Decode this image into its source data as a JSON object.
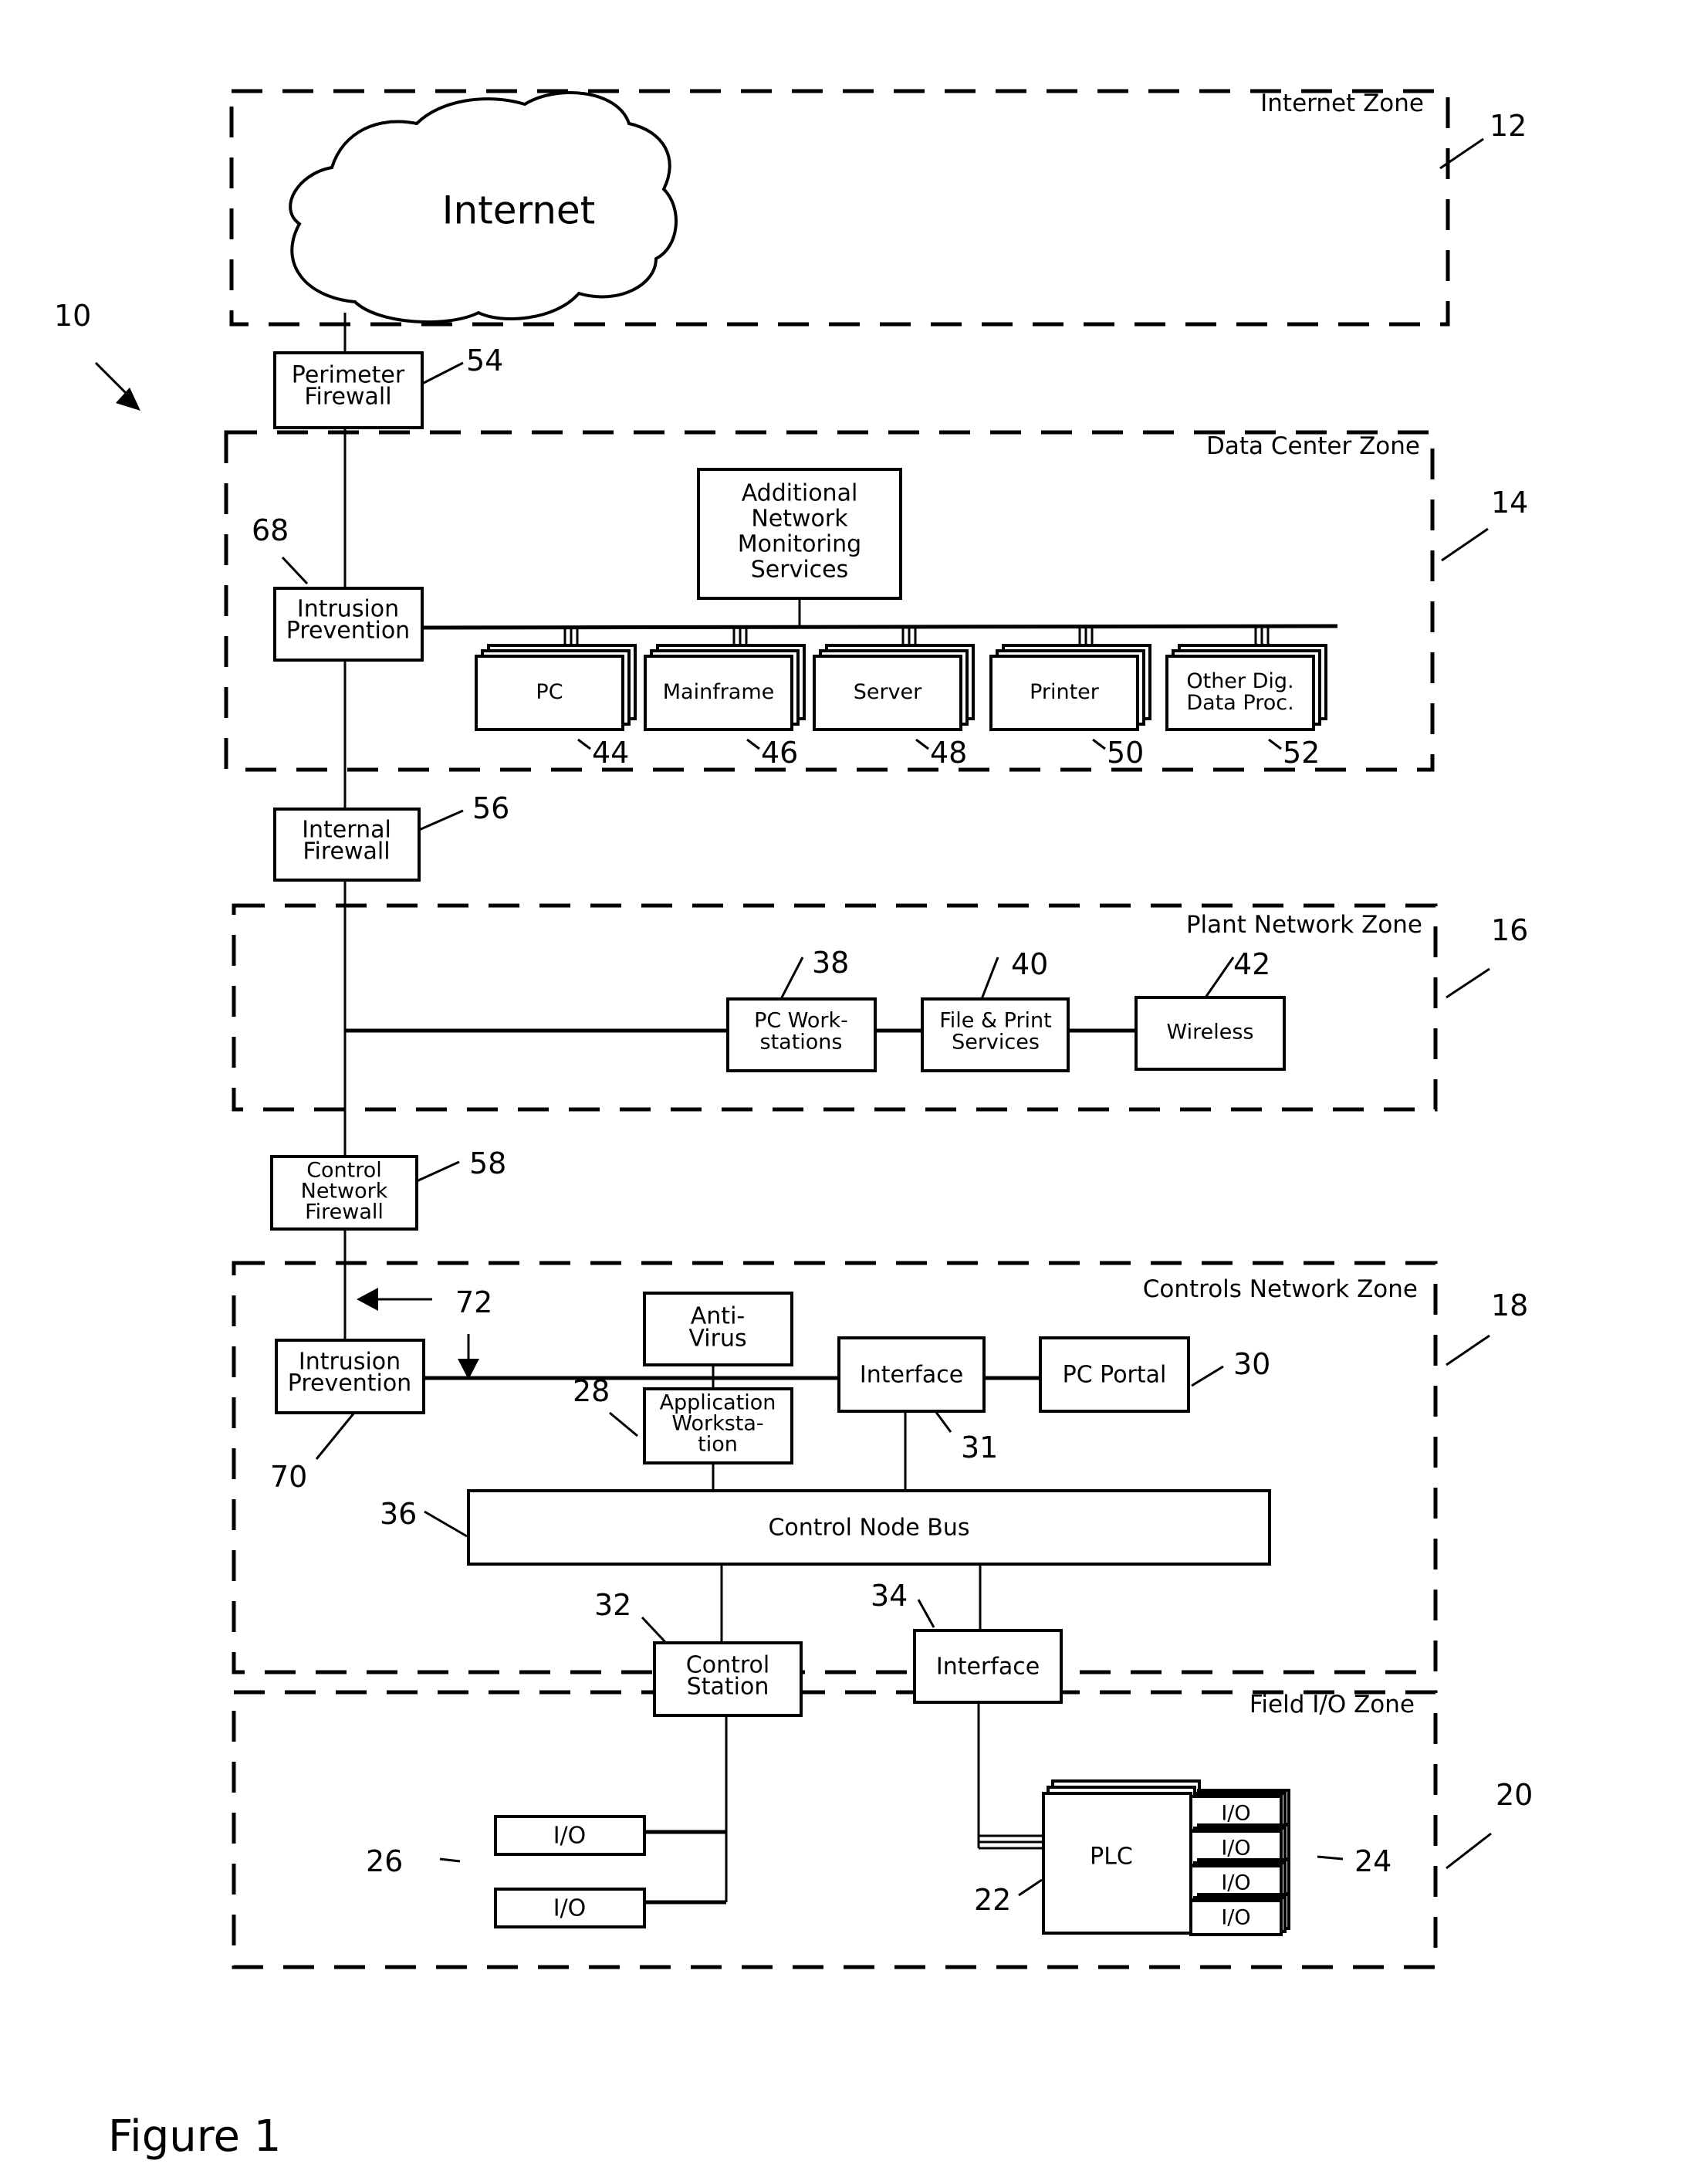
{
  "figure": {
    "title": "Figure 1",
    "ref_system": "10"
  },
  "zones": [
    {
      "id": "internet",
      "label": "Internet Zone",
      "ref": "12"
    },
    {
      "id": "datacenter",
      "label": "Data Center Zone",
      "ref": "14"
    },
    {
      "id": "plant",
      "label": "Plant Network Zone",
      "ref": "16"
    },
    {
      "id": "controls",
      "label": "Controls Network Zone",
      "ref": "18"
    },
    {
      "id": "field",
      "label": "Field I/O Zone",
      "ref": "20"
    }
  ],
  "nodes": {
    "internet": {
      "label": "Internet"
    },
    "perimeter_firewall": {
      "lines": [
        "Perimeter",
        "Firewall"
      ],
      "ref": "54"
    },
    "intrusion_prevention_dc": {
      "lines": [
        "Intrusion",
        "Prevention"
      ],
      "ref": "68"
    },
    "anms": {
      "lines": [
        "Additional",
        "Network",
        "Monitoring",
        "Services"
      ]
    },
    "devices": [
      {
        "lines": [
          "PC"
        ],
        "ref": "44"
      },
      {
        "lines": [
          "Mainframe"
        ],
        "ref": "46"
      },
      {
        "lines": [
          "Server"
        ],
        "ref": "48"
      },
      {
        "lines": [
          "Printer"
        ],
        "ref": "50"
      },
      {
        "lines": [
          "Other Dig.",
          "Data Proc."
        ],
        "ref": "52"
      }
    ],
    "internal_firewall": {
      "lines": [
        "Internal",
        "Firewall"
      ],
      "ref": "56"
    },
    "pc_workstations": {
      "lines": [
        "PC Work-",
        "stations"
      ],
      "ref": "38"
    },
    "file_print": {
      "lines": [
        "File & Print",
        "Services"
      ],
      "ref": "40"
    },
    "wireless": {
      "lines": [
        "Wireless"
      ],
      "ref": "42"
    },
    "control_network_firewall": {
      "lines": [
        "Control",
        "Network",
        "Firewall"
      ],
      "ref": "58"
    },
    "intrusion_prevention_cn": {
      "lines": [
        "Intrusion",
        "Prevention"
      ],
      "ref": "70"
    },
    "arrow_ref": "72",
    "anti_virus": {
      "lines": [
        "Anti-",
        "Virus"
      ]
    },
    "application_workstation": {
      "lines": [
        "Application",
        "Worksta-",
        "tion"
      ],
      "ref": "28"
    },
    "interface_top": {
      "lines": [
        "Interface"
      ],
      "ref": "31"
    },
    "pc_portal": {
      "lines": [
        "PC Portal"
      ],
      "ref": "30"
    },
    "control_node_bus": {
      "label": "Control Node Bus",
      "ref": "36"
    },
    "control_station": {
      "lines": [
        "Control",
        "Station"
      ],
      "ref": "32"
    },
    "interface_bottom": {
      "lines": [
        "Interface"
      ],
      "ref": "34"
    },
    "field_io": {
      "labels": [
        "I/O",
        "I/O"
      ],
      "ref": "26"
    },
    "plc": {
      "label": "PLC",
      "ref": "22"
    },
    "plc_io": {
      "labels": [
        "I/O",
        "I/O",
        "I/O",
        "I/O"
      ],
      "ref": "24"
    }
  }
}
